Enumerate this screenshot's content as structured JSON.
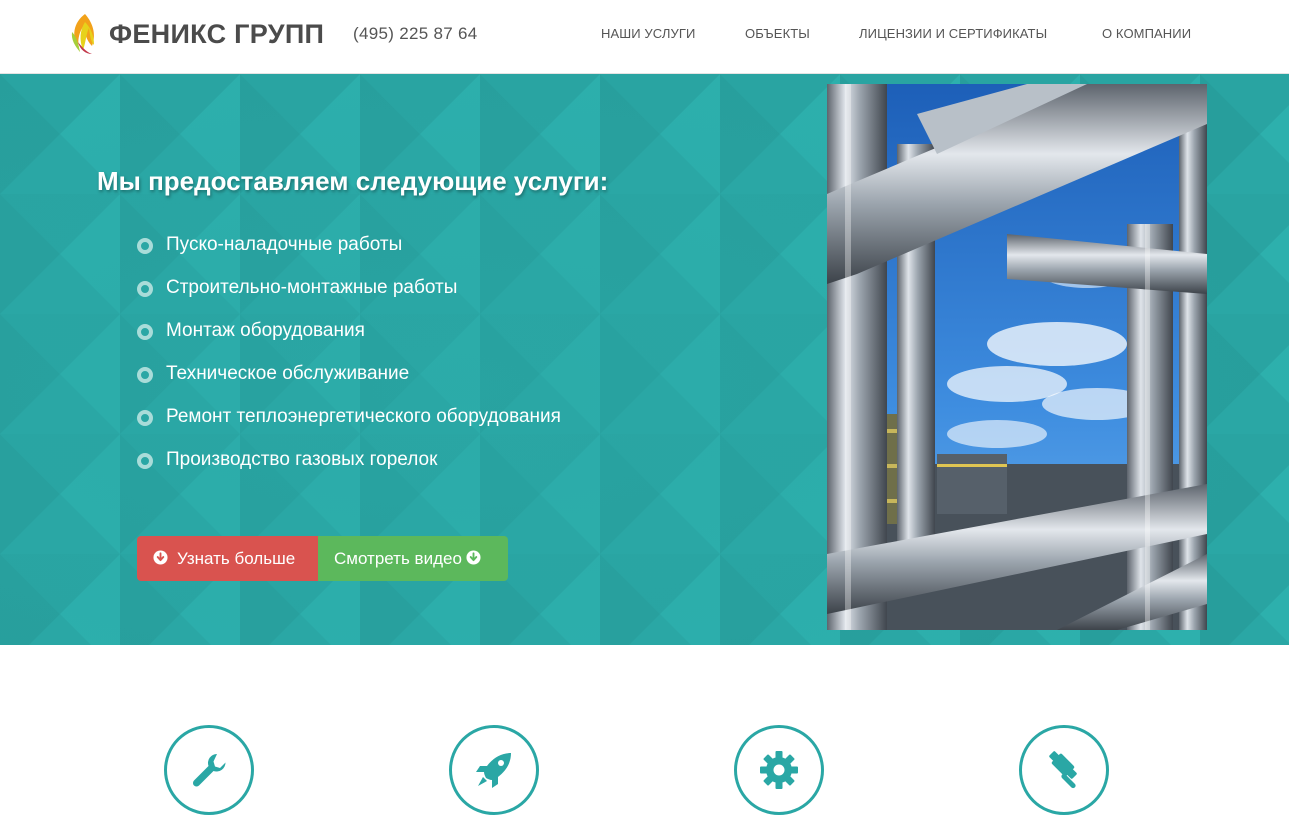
{
  "brand": {
    "name": "ФЕНИКС ГРУПП",
    "logo_icon": "phoenix-flame-logo",
    "phone": "(495) 225 87 64"
  },
  "nav": {
    "items": [
      {
        "label": "НАШИ УСЛУГИ"
      },
      {
        "label": "ОБЪЕКТЫ"
      },
      {
        "label": "ЛИЦЕНЗИИ И СЕРТИФИКАТЫ"
      },
      {
        "label": "О КОМПАНИИ"
      }
    ]
  },
  "hero": {
    "title": "Мы предоставляем следующие услуги:",
    "services": [
      "Пуско-наладочные работы",
      "Строительно-монтажные работы",
      "Монтаж оборудования",
      "Техническое обслуживание",
      "Ремонт теплоэнергетического оборудования",
      "Производство газовых горелок"
    ],
    "buttons": {
      "learn_more": "Узнать больше",
      "learn_more_icon": "arrow-circle-down-icon",
      "watch_video": "Смотреть видео",
      "watch_video_icon": "arrow-circle-down-icon"
    },
    "photo": "industrial-pipes-photo"
  },
  "features": {
    "icons": [
      "wrench-icon",
      "rocket-icon",
      "gear-icon",
      "gavel-icon"
    ]
  },
  "colors": {
    "accent_teal": "#2aa7a5",
    "button_red": "#d9534f",
    "button_green": "#5cb85c",
    "brand_text": "#4b4b4b"
  }
}
